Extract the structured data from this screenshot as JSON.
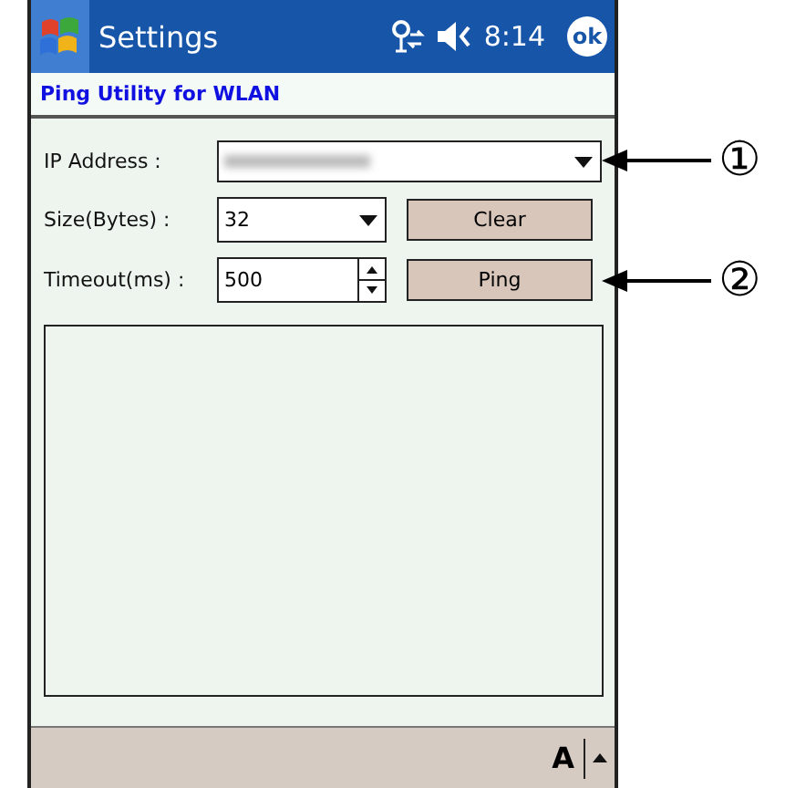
{
  "title_bar": {
    "title": "Settings",
    "time": "8:14",
    "ok": "ok"
  },
  "header": "Ping Utility for WLAN",
  "form": {
    "ip_label": "IP Address  :",
    "size_label": "Size(Bytes) :",
    "size_value": "32",
    "timeout_label": "Timeout(ms) :",
    "timeout_value": "500",
    "clear_button": "Clear",
    "ping_button": "Ping"
  },
  "bottom_bar": {
    "input_label": "A"
  },
  "callouts": [
    "①",
    "②"
  ]
}
